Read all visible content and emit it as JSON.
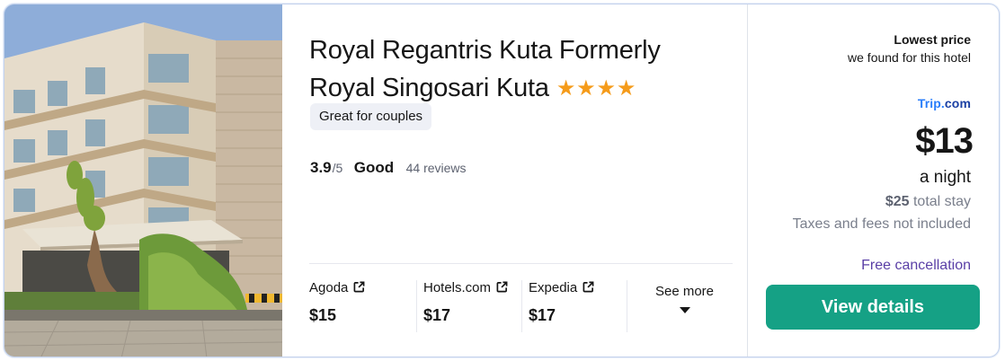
{
  "hotel": {
    "name": "Royal Regantris Kuta Formerly Royal Singosari Kuta",
    "star_count": 4,
    "star_glyph": "★",
    "tag": "Great for couples",
    "rating": {
      "score": "3.9",
      "max": "/5",
      "word": "Good",
      "reviews": "44 reviews"
    }
  },
  "providers": [
    {
      "name": "Agoda",
      "price": "$15",
      "icon": "external-link-icon"
    },
    {
      "name": "Hotels.com",
      "price": "$17",
      "icon": "external-link-icon"
    },
    {
      "name": "Expedia",
      "price": "$17",
      "icon": "external-link-icon"
    }
  ],
  "see_more": {
    "label": "See more",
    "icon": "chevron-down-icon"
  },
  "price_panel": {
    "lowest_title": "Lowest price",
    "lowest_subtitle": "we found for this hotel",
    "vendor": {
      "part1": "Trip",
      "dot": ".",
      "part2": "com"
    },
    "price": "$13",
    "per": "a night",
    "total_amount": "$25",
    "total_label": "total stay",
    "taxes_note": "Taxes and fees not included",
    "cancellation": "Free cancellation",
    "button_label": "View details"
  },
  "colors": {
    "star": "#f59b1a",
    "button": "#15a185",
    "cancellation": "#5a3fa6",
    "vendor": "#287dfa",
    "card_border": "#c5d3ec"
  }
}
